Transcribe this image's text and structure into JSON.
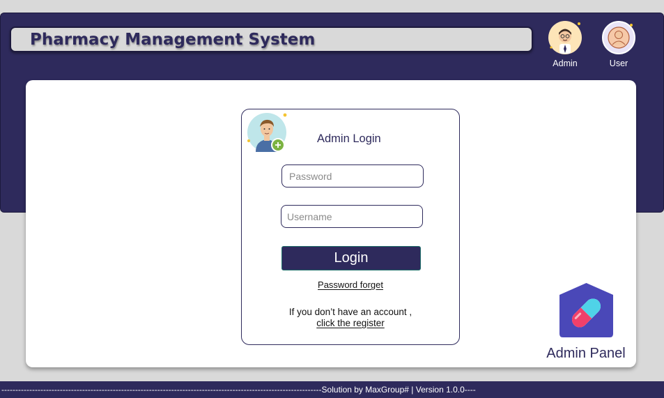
{
  "header": {
    "title": "Pharmacy Management System",
    "roles": [
      {
        "label": "Admin",
        "icon": "admin-avatar-icon"
      },
      {
        "label": "User",
        "icon": "user-avatar-icon"
      }
    ]
  },
  "login": {
    "title": "Admin Login",
    "password_placeholder": "Password",
    "username_placeholder": "Username",
    "login_label": "Login",
    "forget_label": "Password forget",
    "account_prompt": "If you don’t have an account ,",
    "register_label": "click the register"
  },
  "panel": {
    "label": "Admin Panel",
    "icon": "pill-capsule-icon"
  },
  "footer": {
    "text": "-------------------------------------------------------------------------------------------------------------------Solution by MaxGroup# | Version 1.0.0----"
  },
  "colors": {
    "primary": "#2e2a5c",
    "background": "#d9d9d9",
    "card": "#ffffff"
  }
}
